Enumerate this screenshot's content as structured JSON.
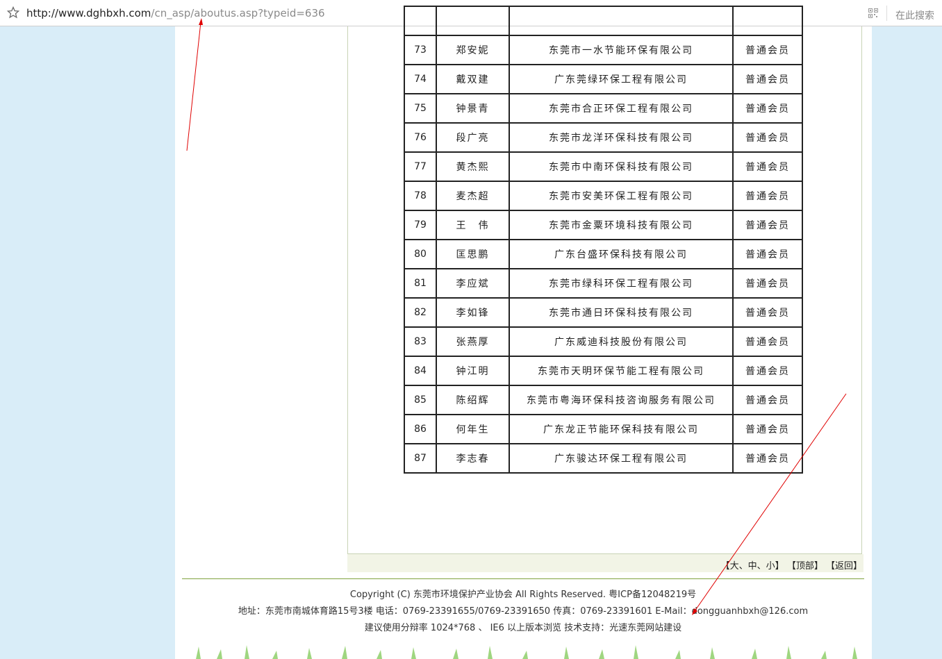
{
  "browser": {
    "url_host": "http://www.dghbxh.com",
    "url_path": "/cn_asp/aboutus.asp?typeid=636",
    "search_label": "在此搜索"
  },
  "members": [
    {
      "no": "",
      "name": "",
      "company": "",
      "level": ""
    },
    {
      "no": "73",
      "name": "郑安妮",
      "company": "东莞市一水节能环保有限公司",
      "level": "普通会员"
    },
    {
      "no": "74",
      "name": "戴双建",
      "company": "广东莞绿环保工程有限公司",
      "level": "普通会员"
    },
    {
      "no": "75",
      "name": "钟景青",
      "company": "东莞市合正环保工程有限公司",
      "level": "普通会员"
    },
    {
      "no": "76",
      "name": "段广亮",
      "company": "东莞市龙洋环保科技有限公司",
      "level": "普通会员"
    },
    {
      "no": "77",
      "name": "黄杰熙",
      "company": "东莞市中南环保科技有限公司",
      "level": "普通会员"
    },
    {
      "no": "78",
      "name": "麦杰超",
      "company": "东莞市安美环保工程有限公司",
      "level": "普通会员"
    },
    {
      "no": "79",
      "name": "王　伟",
      "company": "东莞市金粟环境科技有限公司",
      "level": "普通会员"
    },
    {
      "no": "80",
      "name": "匡思鹏",
      "company": "广东台盛环保科技有限公司",
      "level": "普通会员"
    },
    {
      "no": "81",
      "name": "李应斌",
      "company": "东莞市绿科环保工程有限公司",
      "level": "普通会员"
    },
    {
      "no": "82",
      "name": "李如锋",
      "company": "东莞市通日环保科技有限公司",
      "level": "普通会员"
    },
    {
      "no": "83",
      "name": "张燕厚",
      "company": "广东威迪科技股份有限公司",
      "level": "普通会员"
    },
    {
      "no": "84",
      "name": "钟江明",
      "company": "东莞市天明环保节能工程有限公司",
      "level": "普通会员"
    },
    {
      "no": "85",
      "name": "陈绍辉",
      "company": "东莞市粤海环保科技咨询服务有限公司",
      "level": "普通会员"
    },
    {
      "no": "86",
      "name": "何年生",
      "company": "广东龙正节能环保科技有限公司",
      "level": "普通会员"
    },
    {
      "no": "87",
      "name": "李志春",
      "company": "广东骏达环保工程有限公司",
      "level": "普通会员"
    }
  ],
  "font_controls": {
    "open": "【",
    "large": "大",
    "sep": "、",
    "medium": "中",
    "small": "小",
    "close": "】",
    "top": "【顶部】",
    "back": "【返回】"
  },
  "footer": {
    "copyright": "Copyright (C) 东莞市环境保护产业协会 All Rights Reserved.  粤ICP备12048219号",
    "contact": "地址：东莞市南城体育路15号3楼 电话：0769-23391655/0769-23391650 传真：0769-23391601 E-Mail：dongguanhbxh@126.com",
    "support": "建议使用分辩率 1024*768 、 IE6 以上版本浏览   技术支持：光速东莞网站建设"
  },
  "colors": {
    "side_background": "#d9edf8",
    "footer_rule": "#7fa33f",
    "annotation": "#e00000"
  }
}
